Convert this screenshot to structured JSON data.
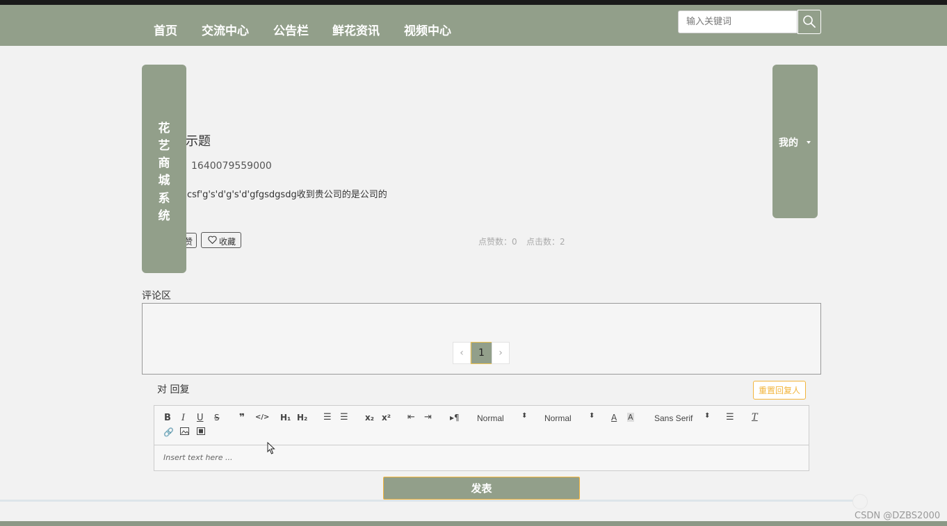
{
  "nav": {
    "items": [
      {
        "label": "首页"
      },
      {
        "label": "交流中心"
      },
      {
        "label": "公告栏"
      },
      {
        "label": "鲜花资讯"
      },
      {
        "label": "视频中心"
      }
    ],
    "search_placeholder": "输入关键词"
  },
  "brand": {
    "chars": [
      "花",
      "艺",
      "商",
      "城",
      "系",
      "统"
    ]
  },
  "mine": {
    "label": "我的"
  },
  "post": {
    "title_fragment": "示题",
    "time": "1640079559000",
    "content": "csf'g's'd'g's'd'gfgsdgsdg收到贵公司的是公司的",
    "like_label": "赞",
    "fav_label": "收藏",
    "likes_stat": "点赞数：0",
    "clicks_stat": "点击数：2"
  },
  "comments": {
    "heading": "评论区",
    "current_page": "1",
    "prev_symbol": "‹",
    "next_symbol": "›"
  },
  "reply": {
    "label": "对 回复",
    "reset_label": "重置回复人"
  },
  "editor": {
    "header_select": "Normal",
    "size_select": "Normal",
    "font_select": "Sans Serif",
    "placeholder": "Insert text here ..."
  },
  "submit_label": "发表",
  "watermark": "CSDN @DZBS2000",
  "colors": {
    "theme": "#929f8a",
    "accent": "#f2b43b"
  }
}
